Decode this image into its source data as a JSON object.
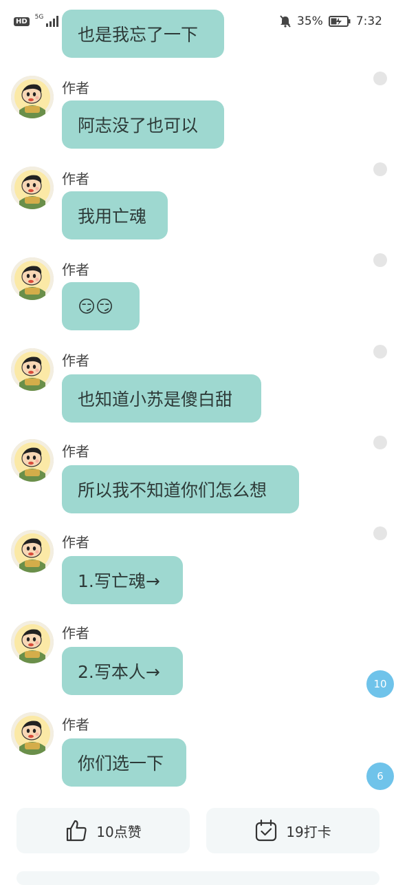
{
  "status_bar": {
    "left_badge": "HD",
    "network": "5G",
    "battery_percent": "35%",
    "time": "7:32",
    "icons": [
      "signal-icon",
      "wifi-icon",
      "mute-bell-icon",
      "battery-charging-icon"
    ]
  },
  "messages": [
    {
      "author": "",
      "text": "也是我忘了一下"
    },
    {
      "author": "作者",
      "text": "阿志没了也可以"
    },
    {
      "author": "作者",
      "text": "我用亡魂"
    },
    {
      "author": "作者",
      "text": "😏😏"
    },
    {
      "author": "作者",
      "text": "也知道小苏是傻白甜"
    },
    {
      "author": "作者",
      "text": "所以我不知道你们怎么想"
    },
    {
      "author": "作者",
      "text": "1.写亡魂→"
    },
    {
      "author": "作者",
      "text": "2.写本人→",
      "badge": "10"
    },
    {
      "author": "作者",
      "text": "你们选一下",
      "badge": "6"
    }
  ],
  "footer": {
    "like_label": "10点赞",
    "checkin_label": "19打卡"
  },
  "colors": {
    "bubble": "#9ed8d0",
    "badge": "#6fc3ea",
    "read_dot": "#e5e5e5"
  }
}
